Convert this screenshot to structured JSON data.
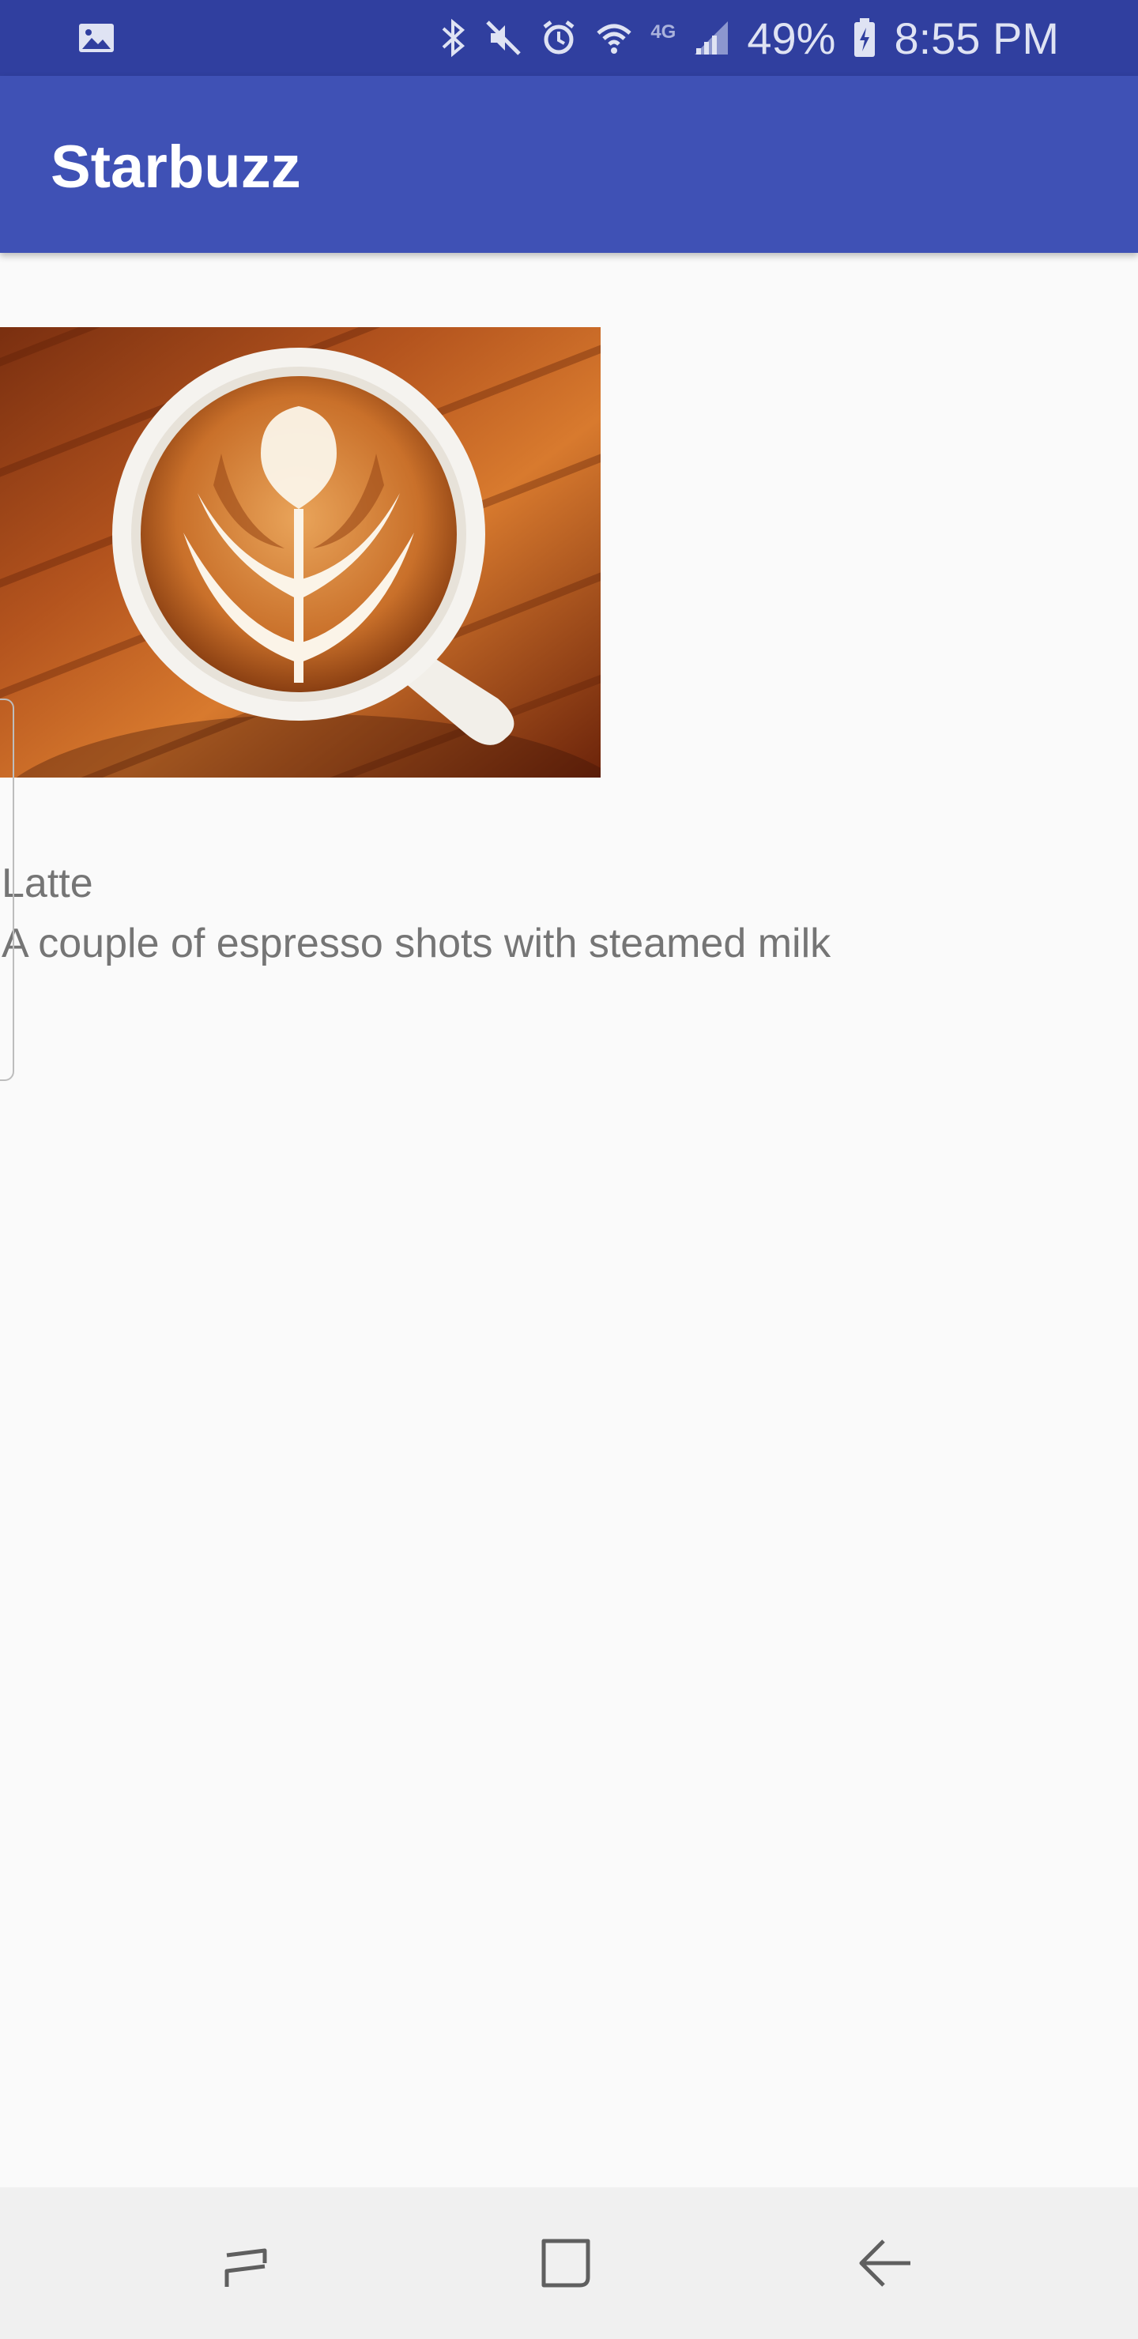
{
  "status_bar": {
    "battery": "49%",
    "time": "8:55 PM",
    "network": "4G",
    "icons": [
      "gallery-icon",
      "bluetooth-icon",
      "mute-icon",
      "alarm-icon",
      "wifi-icon",
      "network-type-icon",
      "signal-icon",
      "battery-icon"
    ]
  },
  "app_bar": {
    "title": "Starbuzz"
  },
  "drink": {
    "name": "Latte",
    "description": "A couple of espresso shots with steamed milk",
    "image_icon": "latte-photo"
  },
  "nav_bar": {
    "icons": [
      "recents-icon",
      "home-icon",
      "back-icon"
    ]
  },
  "colors": {
    "status_bar": "#303f9f",
    "app_bar": "#3f51b5",
    "background": "#fafafa",
    "text_secondary": "#757575",
    "nav_bar": "#f0f0f0"
  }
}
